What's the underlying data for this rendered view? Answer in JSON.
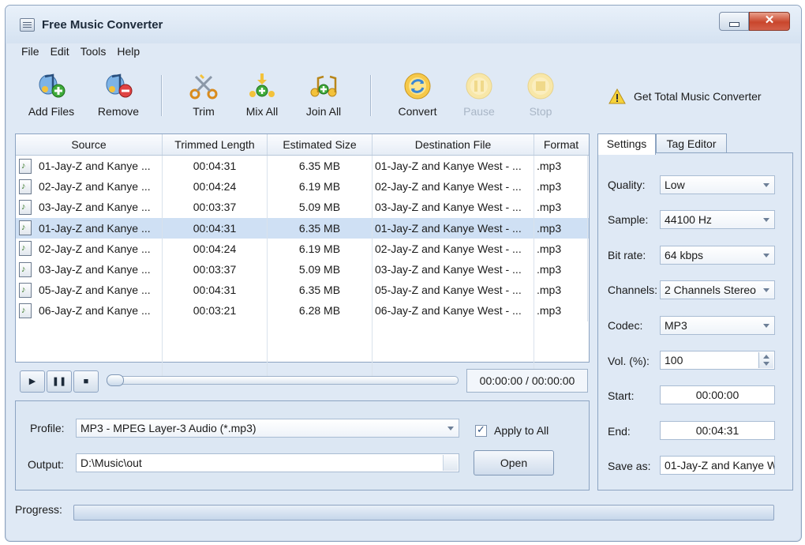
{
  "window": {
    "title": "Free Music Converter",
    "close_glyph": "✕"
  },
  "menu": [
    "File",
    "Edit",
    "Tools",
    "Help"
  ],
  "toolbar": {
    "add_files": "Add Files",
    "remove": "Remove",
    "trim": "Trim",
    "mix_all": "Mix All",
    "join_all": "Join All",
    "convert": "Convert",
    "pause": "Pause",
    "stop": "Stop",
    "promo": "Get Total Music Converter"
  },
  "table": {
    "columns": [
      "Source",
      "Trimmed Length",
      "Estimated Size",
      "Destination File",
      "Format"
    ],
    "rows": [
      {
        "source": "01-Jay-Z and Kanye ...",
        "length": "00:04:31",
        "size": "6.35 MB",
        "dest": "01-Jay-Z and Kanye West - ...",
        "format": ".mp3",
        "selected": false
      },
      {
        "source": "02-Jay-Z and Kanye ...",
        "length": "00:04:24",
        "size": "6.19 MB",
        "dest": "02-Jay-Z and Kanye West - ...",
        "format": ".mp3",
        "selected": false
      },
      {
        "source": "03-Jay-Z and Kanye ...",
        "length": "00:03:37",
        "size": "5.09 MB",
        "dest": "03-Jay-Z and Kanye West - ...",
        "format": ".mp3",
        "selected": false
      },
      {
        "source": "01-Jay-Z and Kanye ...",
        "length": "00:04:31",
        "size": "6.35 MB",
        "dest": "01-Jay-Z and Kanye West - ...",
        "format": ".mp3",
        "selected": true
      },
      {
        "source": "02-Jay-Z and Kanye ...",
        "length": "00:04:24",
        "size": "6.19 MB",
        "dest": "02-Jay-Z and Kanye West - ...",
        "format": ".mp3",
        "selected": false
      },
      {
        "source": "03-Jay-Z and Kanye ...",
        "length": "00:03:37",
        "size": "5.09 MB",
        "dest": "03-Jay-Z and Kanye West - ...",
        "format": ".mp3",
        "selected": false
      },
      {
        "source": "05-Jay-Z and Kanye ...",
        "length": "00:04:31",
        "size": "6.35 MB",
        "dest": "05-Jay-Z and Kanye West - ...",
        "format": ".mp3",
        "selected": false
      },
      {
        "source": "06-Jay-Z and Kanye ...",
        "length": "00:03:21",
        "size": "6.28 MB",
        "dest": "06-Jay-Z and Kanye West - ...",
        "format": ".mp3",
        "selected": false
      }
    ]
  },
  "player": {
    "play": "▶",
    "pause": "❚❚",
    "stop": "■",
    "time": "00:00:00 / 00:00:00",
    "seek_position": 0
  },
  "output": {
    "profile_label": "Profile:",
    "profile_value": "MP3 - MPEG Layer-3 Audio (*.mp3)",
    "apply_all": "Apply to All",
    "apply_all_checked": true,
    "output_label": "Output:",
    "output_value": "D:\\Music\\out",
    "open": "Open"
  },
  "tabs": {
    "settings": "Settings",
    "tag_editor": "Tag Editor"
  },
  "settings": {
    "quality_label": "Quality:",
    "quality": "Low",
    "sample_label": "Sample:",
    "sample": "44100 Hz",
    "bitrate_label": "Bit rate:",
    "bitrate": "64 kbps",
    "channels_label": "Channels:",
    "channels": "2 Channels Stereo",
    "codec_label": "Codec:",
    "codec": "MP3",
    "vol_label": "Vol. (%):",
    "vol": "100",
    "start_label": "Start:",
    "start": "00:00:00",
    "end_label": "End:",
    "end": "00:04:31",
    "saveas_label": "Save as:",
    "saveas": "01-Jay-Z and Kanye W"
  },
  "progress": {
    "label": "Progress:",
    "value": 0
  }
}
